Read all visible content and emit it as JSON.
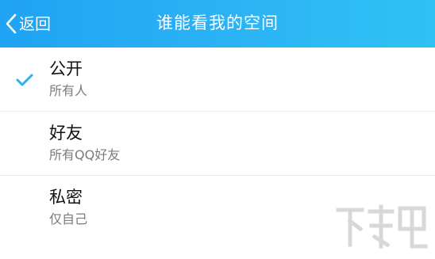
{
  "header": {
    "back_label": "返回",
    "title": "谁能看我的空间"
  },
  "options": [
    {
      "title": "公开",
      "subtitle": "所有人",
      "selected": true
    },
    {
      "title": "好友",
      "subtitle": "所有QQ好友",
      "selected": false
    },
    {
      "title": "私密",
      "subtitle": "仅自己",
      "selected": false
    }
  ],
  "watermark": {
    "text": "下载吧"
  },
  "colors": {
    "header_start": "#1fa3f3",
    "header_end": "#2fc2f3",
    "check": "#27b3ee"
  }
}
